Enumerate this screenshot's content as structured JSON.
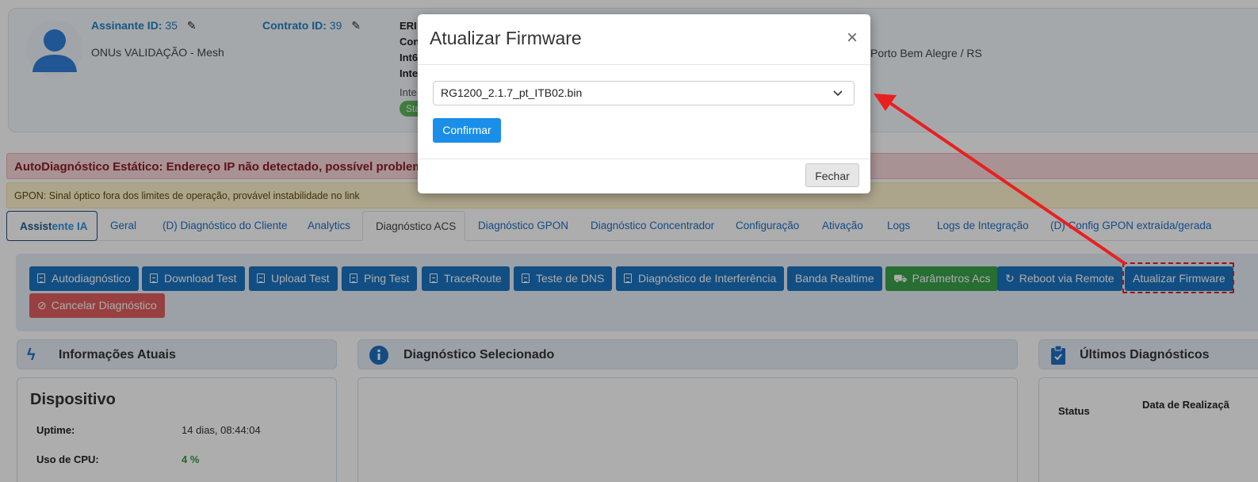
{
  "header": {
    "subscriber_label": "Assinante ID:",
    "subscriber_id": "35",
    "contract_label": "Contrato ID:",
    "contract_id": "39",
    "customer_name": "ONUs VALIDAÇÃO - Mesh",
    "col3_line1": "ERI",
    "col3_line2": "Con",
    "col3_line3": "Int6",
    "col3_line4": "Inte",
    "col3_line5": "Inte",
    "status_badge": "Sta",
    "city": "Porto Bem Alegre / RS"
  },
  "alerts": {
    "danger": "AutoDiagnóstico Estático: Endereço IP não detectado, possível problem",
    "warning": "GPON: Sinal óptico fora dos limites de operação, provável instabilidade no link"
  },
  "tabs": {
    "ia_prefix": "Assist",
    "ia_suffix": "ente IA",
    "geral": "Geral",
    "diag_cliente": "(D) Diagnóstico do Cliente",
    "analytics": "Analytics",
    "diag_acs": "Diagnóstico ACS",
    "diag_gpon": "Diagnóstico GPON",
    "diag_concentrador": "Diagnóstico Concentrador",
    "configuracao": "Configuração",
    "ativacao": "Ativação",
    "logs": "Logs",
    "logs_integracao": "Logs de Integração",
    "config_gpon": "(D) Config GPON extraída/gerada"
  },
  "actions": {
    "autodiagnostico": "Autodiagnóstico",
    "download_test": "Download Test",
    "upload_test": "Upload Test",
    "ping_test": "Ping Test",
    "traceroute": "TraceRoute",
    "teste_dns": "Teste de DNS",
    "diag_interferencia": "Diagnóstico de Interferência",
    "banda_realtime": "Banda Realtime",
    "parametros_acs": "Parâmetros Acs",
    "reboot_remote": "Reboot via Remote",
    "atualizar_firmware": "Atualizar Firmware",
    "cancelar_diagnostico": "Cancelar Diagnóstico"
  },
  "panels": {
    "info_atuais": "Informações Atuais",
    "diag_selecionado": "Diagnóstico Selecionado",
    "ultimos_diag": "Últimos Diagnósticos"
  },
  "device": {
    "title": "Dispositivo",
    "uptime_label": "Uptime:",
    "uptime_value": "14 dias, 08:44:04",
    "cpu_label": "Uso de CPU:",
    "cpu_value": "4 %"
  },
  "last_diag_table": {
    "col_status": "Status",
    "col_date": "Data de Realizaçã"
  },
  "modal": {
    "title": "Atualizar Firmware",
    "selected_firmware": "RG1200_2.1.7_pt_ITB02.bin",
    "confirm_label": "Confirmar",
    "close_label": "Fechar"
  },
  "colors": {
    "primary": "#1a73c2",
    "success": "#3aa34a",
    "danger": "#e05d5d",
    "annotation": "#e02020"
  }
}
